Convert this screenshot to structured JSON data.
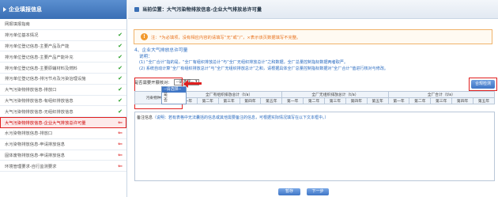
{
  "sidebar": {
    "title": "企业填报信息",
    "items": [
      {
        "label": "网报填报指南",
        "mark": ""
      },
      {
        "label": "排污单位基本情况",
        "mark": "check"
      },
      {
        "label": "排污单位登记信息-主要产品及产能",
        "mark": "check"
      },
      {
        "label": "排污单位登记信息-主要产品产能补充",
        "mark": "check"
      },
      {
        "label": "排污单位登记信息-主要原辅材料及燃料",
        "mark": "check"
      },
      {
        "label": "排污单位登记信息-排污节点及污染治理设施",
        "mark": "check"
      },
      {
        "label": "大气污染物排放信息-排放口",
        "mark": "check"
      },
      {
        "label": "大气污染物排放信息-有组织排放信息",
        "mark": "check"
      },
      {
        "label": "大气污染物排放信息-无组织排放信息",
        "mark": "check"
      },
      {
        "label": "大气污染物排放信息-企业大气排放总许可量",
        "mark": "arrow"
      },
      {
        "label": "水污染物排放信息-排放口",
        "mark": "arrow"
      },
      {
        "label": "水污染物排放信息-申请排放信息",
        "mark": "arrow"
      },
      {
        "label": "固体废物排放信息-申请排放信息",
        "mark": "arrow"
      },
      {
        "label": "环境管理要求-自行监测要求",
        "mark": "arrow"
      }
    ],
    "active_index": 9
  },
  "crumb": "当前位置：大气污染物排放信息-企业大气排放总许可量",
  "tip": "注：*为必填项，没有相应内容的请填写“无”或“/”，×表示该页数据填写不完整。",
  "section_title": "4、企业大气排放总许可量",
  "explain_label": "说明：",
  "explain_lines": [
    "(1) “全厂合计”指的是，“全厂有组织排放总计”与“全厂无组织排放总计”之和数据，全厂总量控制指标数据两者取严。",
    "(2) 系统自动计算“全厂有组织排放总计”与“全厂无组织排放总计”之和，请根据具体全厂总量控制指标数据对“全厂合计”值进行核对与修改。"
  ],
  "exceed_label": "是否需要开展核对：",
  "select_value": "--请选择--",
  "dropdown_options": [
    "--请选择--",
    "是",
    "否"
  ],
  "dropdown_selected": 0,
  "check_button": "合规检测",
  "table": {
    "first_col": "污染物种类",
    "groups": [
      "全厂有组织排放总计（t/a）",
      "全厂无组织排放总计（t/a）",
      "全厂合计（t/a）"
    ],
    "years": [
      "第一年",
      "第二年",
      "第三年",
      "第四年",
      "第五年"
    ]
  },
  "note_label": "备注信息",
  "note_text": "（说明：若有表格中无法囊括的信息或其他需要备注的信息，可根据实际情况填写在以下文本框中。）",
  "buttons": {
    "save": "暂存",
    "next": "下一步"
  }
}
